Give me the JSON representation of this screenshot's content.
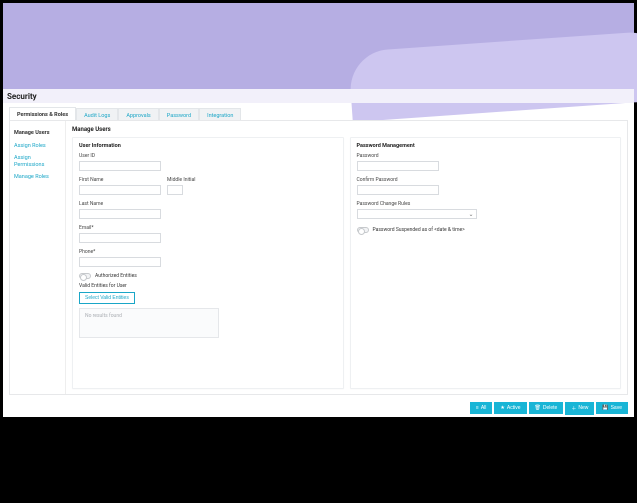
{
  "header": {
    "title": "Security"
  },
  "tabs": [
    {
      "label": "Permissions & Roles",
      "active": true
    },
    {
      "label": "Audit Logs"
    },
    {
      "label": "Approvals"
    },
    {
      "label": "Password"
    },
    {
      "label": "Integration"
    }
  ],
  "sidebar": {
    "items": [
      {
        "label": "Manage Users",
        "active": true
      },
      {
        "label": "Assign Roles"
      },
      {
        "label": "Assign Permissions"
      },
      {
        "label": "Manage Roles"
      }
    ]
  },
  "main": {
    "heading": "Manage Users",
    "userInfoCard": {
      "title": "User Information",
      "fields": {
        "userIdLabel": "User ID",
        "firstNameLabel": "First Name",
        "middleInitialLabel": "Middle Initial",
        "lastNameLabel": "Last Name",
        "emailLabel": "Email*",
        "phoneLabel": "Phone*"
      },
      "authorizedEntitiesLabel": "Authorized Entities",
      "validEntitiesLabel": "Valid Entities for User",
      "selectValidEntitiesBtn": "Select Valid Entities",
      "noResultsText": "No results found"
    },
    "passwordCard": {
      "title": "Password Management",
      "passwordLabel": "Password",
      "confirmPasswordLabel": "Confirm Password",
      "changeRulesLabel": "Password Change Rules",
      "suspendedLabel": "Password Suspended as of <date & time>"
    }
  },
  "footer": {
    "buttons": {
      "all": "All",
      "active": "Active",
      "delete": "Delete",
      "new": "New",
      "save": "Save"
    }
  }
}
